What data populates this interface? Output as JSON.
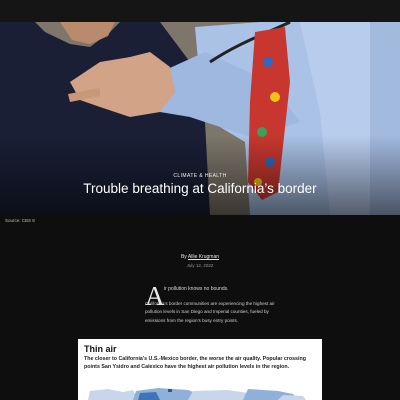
{
  "hero": {
    "kicker": "CLIMATE & HEALTH",
    "headline": "Trouble breathing at California’s border",
    "image_description": "doctor listening to patient’s breathing with stethoscope"
  },
  "caption": "Source: CBS 8",
  "byline": {
    "prefix": "By ",
    "author": "Allie Krugman",
    "date": "July 12, 2022"
  },
  "article": {
    "dropcap": "A",
    "intro": "ir pollution knows no bounds.",
    "paragraph": "California’s border communities are experiencing the highest air pollution levels in San Diego and Imperial counties, fueled by emissions from the region’s busy entry points."
  },
  "map_card": {
    "title": "Thin air",
    "description": "The closer to California’s U.S.-Mexico border, the worse the air quality. Popular crossing points San Ysidro and Calexico have the highest air pollution levels in the region.",
    "colors": {
      "light": "#c7d6ea",
      "mid": "#8fb1d8",
      "dark": "#3f74b7",
      "darkest": "#2a5796"
    }
  },
  "colors": {
    "background": "#0e0e0e",
    "headline": "#ffffff"
  }
}
